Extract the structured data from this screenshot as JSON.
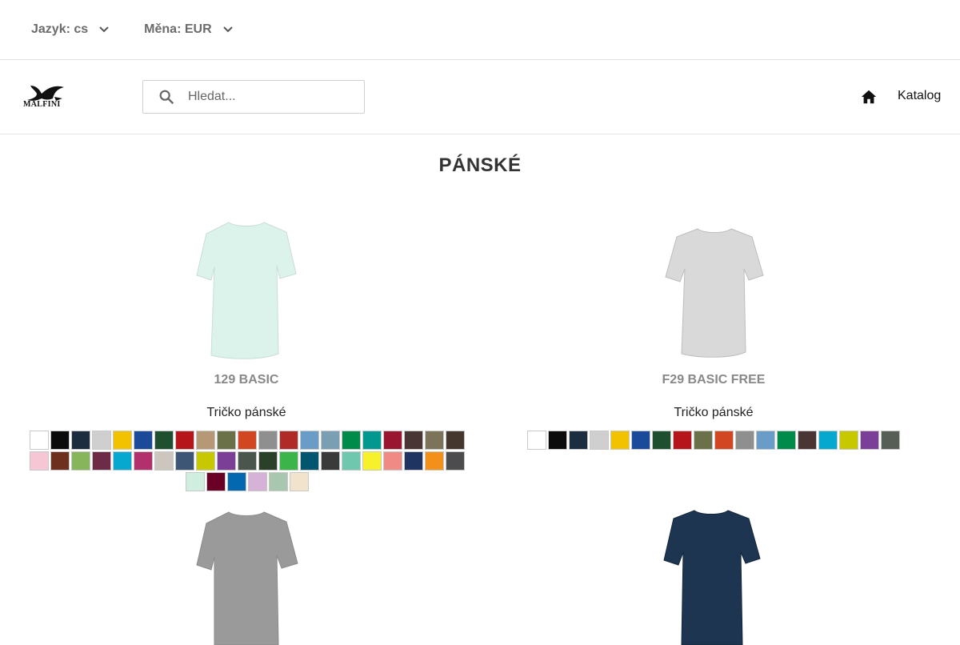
{
  "topbar": {
    "language_label": "Jazyk: cs",
    "currency_label": "Měna: EUR"
  },
  "header": {
    "logo_text": "MALFINI",
    "search_placeholder": "Hledat...",
    "katalog_label": "Katalog"
  },
  "page_title": "PÁNSKÉ",
  "products": [
    {
      "name": "129 BASIC",
      "subtitle": "Tričko pánské",
      "tee_color": "#dcf3ec",
      "colors": [
        "#ffffff",
        "#0b0b0b",
        "#1c2d40",
        "#cfcfcf",
        "#f2c200",
        "#1b4a9a",
        "#1e5030",
        "#b5151b",
        "#b69877",
        "#6a7048",
        "#d24722",
        "#8f8f8f",
        "#b02a28",
        "#6a9cc8",
        "#7a9fb2",
        "#008b4a",
        "#00988f",
        "#9a1630",
        "#4a3535",
        "#7b745b",
        "#45362e",
        "#f7c6d4",
        "#6d2f1e",
        "#86b55c",
        "#6e2b47",
        "#06a8d0",
        "#b2306c",
        "#ccc6bf",
        "#3d5675",
        "#c8c800",
        "#7b3f98",
        "#4a554d",
        "#2a4029",
        "#3bb44a",
        "#00566e",
        "#3a3a3a",
        "#6fc8ae",
        "#f6f12a",
        "#f08a84",
        "#1f3460",
        "#f39019",
        "#4c4c4f",
        "#cfeee0",
        "#6b0026",
        "#0368b0",
        "#d6b3d6",
        "#a8c7ae",
        "#f2e4cc"
      ]
    },
    {
      "name": "F29 BASIC FREE",
      "subtitle": "Tričko pánské",
      "tee_color": "#d9d9d9",
      "colors": [
        "#ffffff",
        "#0b0b0b",
        "#1c2d40",
        "#cfcfcf",
        "#f2c200",
        "#1b4a9a",
        "#1e5030",
        "#b5151b",
        "#6a7048",
        "#d24722",
        "#8f8f8f",
        "#6a9cc8",
        "#008b4a",
        "#4a3535",
        "#06a8d0",
        "#c8c800",
        "#7b3f98",
        "#565e55"
      ]
    },
    {
      "tee_color": "#9a9a9a"
    },
    {
      "tee_color": "#1d3550"
    }
  ]
}
